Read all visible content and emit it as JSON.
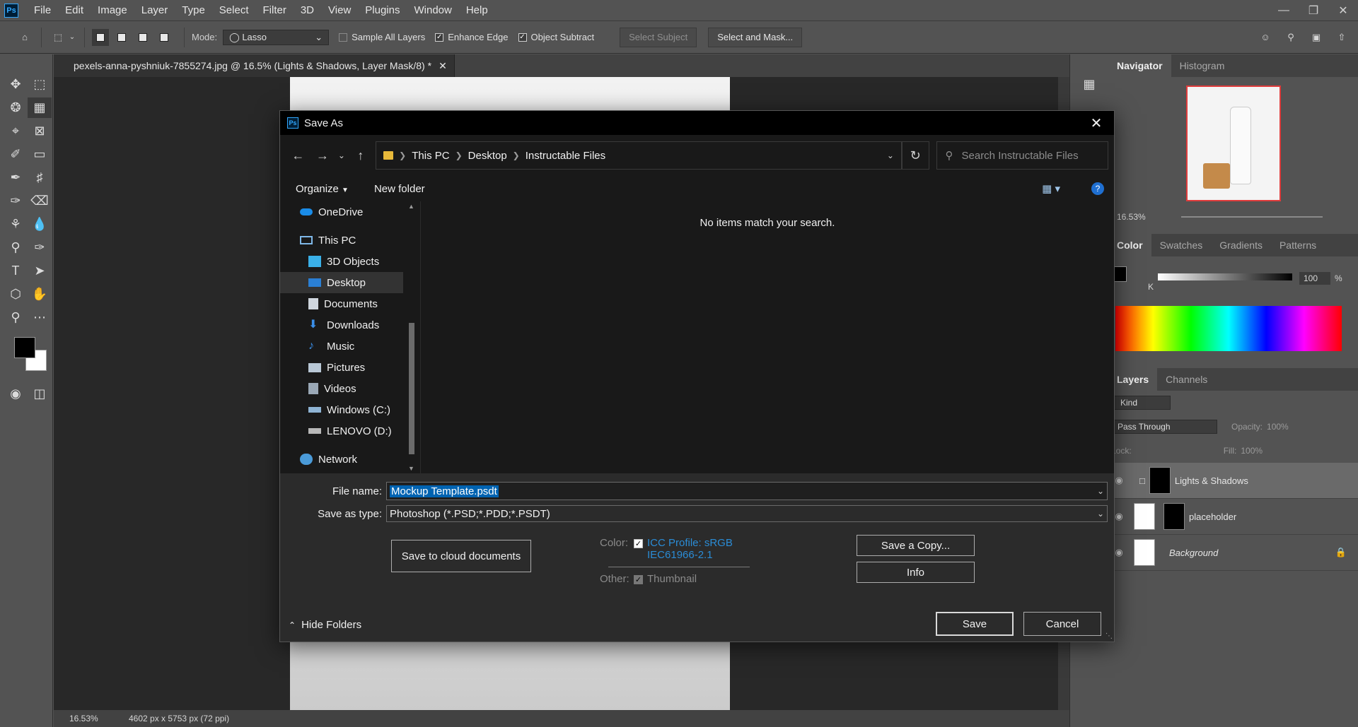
{
  "menu": {
    "logo": "Ps",
    "items": [
      "File",
      "Edit",
      "Image",
      "Layer",
      "Type",
      "Select",
      "Filter",
      "3D",
      "View",
      "Plugins",
      "Window",
      "Help"
    ]
  },
  "options": {
    "mode_label": "Mode:",
    "mode_value": "Lasso",
    "sample_all_layers": "Sample All Layers",
    "enhance_edge": "Enhance Edge",
    "object_subtract": "Object Subtract",
    "select_subject": "Select Subject",
    "select_and_mask": "Select and Mask..."
  },
  "document": {
    "tab_title": "pexels-anna-pyshniuk-7855274.jpg @ 16.5% (Lights & Shadows, Layer Mask/8) *",
    "zoom": "16.53%",
    "dimensions": "4602 px x 5753 px (72 ppi)"
  },
  "panels": {
    "navigator_tabs": [
      "Navigator",
      "Histogram"
    ],
    "nav_zoom": "16.53%",
    "color_tabs": [
      "Color",
      "Swatches",
      "Gradients",
      "Patterns"
    ],
    "color_channel": "K",
    "color_value": "100",
    "color_unit": "%",
    "layers_tabs": [
      "Layers",
      "Channels"
    ],
    "kind_label": "Kind",
    "blend_mode": "Pass Through",
    "opacity_label": "Opacity:",
    "opacity_value": "100%",
    "lock_label": "Lock:",
    "fill_label": "Fill:",
    "fill_value": "100%",
    "layers": [
      {
        "name": "Lights & Shadows"
      },
      {
        "name": "placeholder"
      },
      {
        "name": "Background"
      }
    ]
  },
  "dialog": {
    "title": "Save As",
    "path": [
      "This PC",
      "Desktop",
      "Instructable Files"
    ],
    "search_placeholder": "Search Instructable Files",
    "organize": "Organize",
    "new_folder": "New folder",
    "tree": [
      {
        "label": "OneDrive",
        "icon": "cloud-icon"
      },
      {
        "label": "This PC",
        "icon": "pc-icon"
      },
      {
        "label": "3D Objects",
        "icon": "cube-icon"
      },
      {
        "label": "Desktop",
        "icon": "desktop-icon"
      },
      {
        "label": "Documents",
        "icon": "document-icon"
      },
      {
        "label": "Downloads",
        "icon": "download-icon"
      },
      {
        "label": "Music",
        "icon": "music-icon"
      },
      {
        "label": "Pictures",
        "icon": "picture-icon"
      },
      {
        "label": "Videos",
        "icon": "video-icon"
      },
      {
        "label": "Windows (C:)",
        "icon": "drive-icon"
      },
      {
        "label": "LENOVO (D:)",
        "icon": "drive-icon"
      },
      {
        "label": "Network",
        "icon": "network-icon"
      }
    ],
    "empty_message": "No items match your search.",
    "file_name_label": "File name:",
    "file_name_value": "Mockup Template.psdt",
    "save_as_type_label": "Save as type:",
    "save_as_type_value": "Photoshop (*.PSD;*.PDD;*.PSDT)",
    "save_cloud": "Save to cloud documents",
    "color_label": "Color:",
    "icc_profile_line1": "ICC Profile:  sRGB",
    "icc_profile_line2": "IEC61966-2.1",
    "other_label": "Other:",
    "thumbnail": "Thumbnail",
    "save_copy": "Save a Copy...",
    "info": "Info",
    "hide_folders": "Hide Folders",
    "save": "Save",
    "cancel": "Cancel"
  }
}
